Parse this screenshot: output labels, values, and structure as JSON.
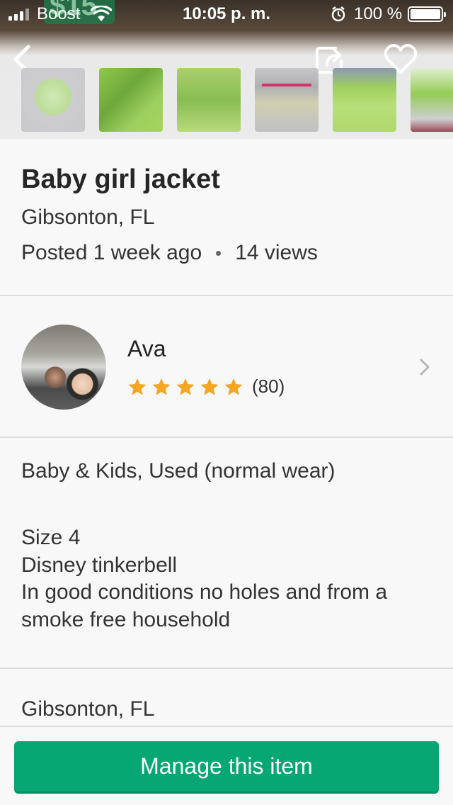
{
  "status_bar": {
    "carrier": "Boost",
    "time": "10:05 p. m.",
    "battery": "100 %"
  },
  "background_price": "$15",
  "listing": {
    "title": "Baby girl jacket",
    "location": "Gibsonton, FL",
    "posted": "Posted 1 week ago",
    "views": "14 views",
    "category": "Baby & Kids, Used (normal wear)",
    "description_lines": [
      "Size 4",
      "Disney tinkerbell",
      "In good conditions no holes and from a",
      "smoke free household"
    ],
    "map_location": "Gibsonton, FL"
  },
  "seller": {
    "name": "Ava",
    "rating": 5,
    "rating_count": "(80)"
  },
  "actions": {
    "manage_label": "Manage this item"
  },
  "icons": [
    "back-icon",
    "share-icon",
    "heart-icon",
    "star-icon",
    "chevron-right-icon",
    "wifi-icon",
    "alarm-icon",
    "battery-icon"
  ],
  "colors": {
    "primary_green": "#06a773",
    "star_orange": "#f5a623"
  }
}
